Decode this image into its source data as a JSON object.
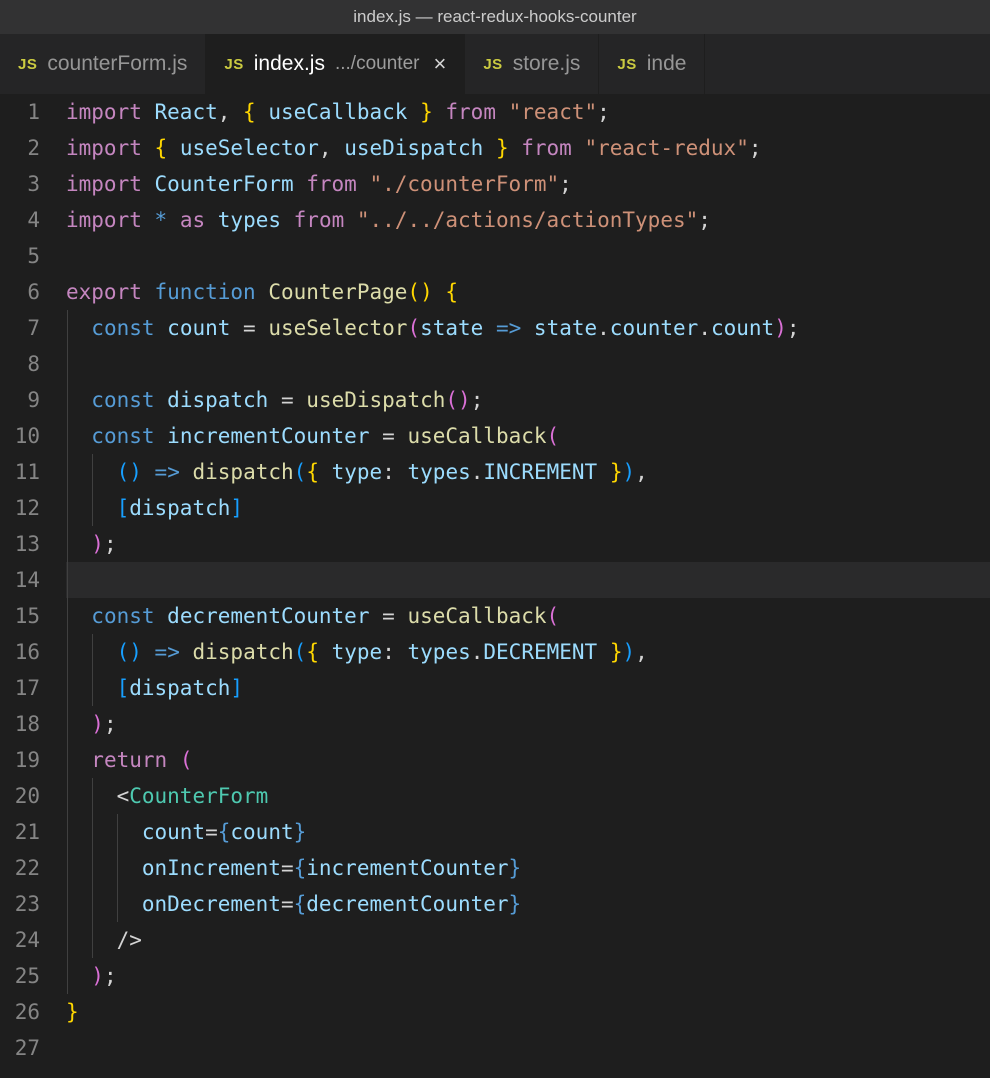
{
  "titlebar": "index.js — react-redux-hooks-counter",
  "tabs": [
    {
      "icon": "JS",
      "label": "counterForm.js",
      "path": "",
      "active": false,
      "close": false
    },
    {
      "icon": "JS",
      "label": "index.js",
      "path": ".../counter",
      "active": true,
      "close": true
    },
    {
      "icon": "JS",
      "label": "store.js",
      "path": "",
      "active": false,
      "close": false
    },
    {
      "icon": "JS",
      "label": "inde",
      "path": "",
      "active": false,
      "close": false
    }
  ],
  "lineCount": 27,
  "currentLine": 14,
  "code": {
    "l1": [
      [
        "k",
        "import"
      ],
      [
        "w",
        " "
      ],
      [
        "v",
        "React"
      ],
      [
        "p",
        ", "
      ],
      [
        "br",
        "{"
      ],
      [
        "w",
        " "
      ],
      [
        "v",
        "useCallback"
      ],
      [
        "w",
        " "
      ],
      [
        "br",
        "}"
      ],
      [
        "w",
        " "
      ],
      [
        "k",
        "from"
      ],
      [
        "w",
        " "
      ],
      [
        "s",
        "\"react\""
      ],
      [
        "p",
        ";"
      ]
    ],
    "l2": [
      [
        "k",
        "import"
      ],
      [
        "w",
        " "
      ],
      [
        "br",
        "{"
      ],
      [
        "w",
        " "
      ],
      [
        "v",
        "useSelector"
      ],
      [
        "p",
        ", "
      ],
      [
        "v",
        "useDispatch"
      ],
      [
        "w",
        " "
      ],
      [
        "br",
        "}"
      ],
      [
        "w",
        " "
      ],
      [
        "k",
        "from"
      ],
      [
        "w",
        " "
      ],
      [
        "s",
        "\"react-redux\""
      ],
      [
        "p",
        ";"
      ]
    ],
    "l3": [
      [
        "k",
        "import"
      ],
      [
        "w",
        " "
      ],
      [
        "v",
        "CounterForm"
      ],
      [
        "w",
        " "
      ],
      [
        "k",
        "from"
      ],
      [
        "w",
        " "
      ],
      [
        "s",
        "\"./counterForm\""
      ],
      [
        "p",
        ";"
      ]
    ],
    "l4": [
      [
        "k",
        "import"
      ],
      [
        "w",
        " "
      ],
      [
        "kb",
        "*"
      ],
      [
        "w",
        " "
      ],
      [
        "k",
        "as"
      ],
      [
        "w",
        " "
      ],
      [
        "v",
        "types"
      ],
      [
        "w",
        " "
      ],
      [
        "k",
        "from"
      ],
      [
        "w",
        " "
      ],
      [
        "s",
        "\"../../actions/actionTypes\""
      ],
      [
        "p",
        ";"
      ]
    ],
    "l5": [],
    "l6": [
      [
        "k",
        "export"
      ],
      [
        "w",
        " "
      ],
      [
        "kb",
        "function"
      ],
      [
        "w",
        " "
      ],
      [
        "fn",
        "CounterPage"
      ],
      [
        "br",
        "("
      ],
      [
        "br",
        ")"
      ],
      [
        "w",
        " "
      ],
      [
        "br",
        "{"
      ]
    ],
    "l7": [
      [
        "w",
        "  "
      ],
      [
        "kb",
        "const"
      ],
      [
        "w",
        " "
      ],
      [
        "v",
        "count"
      ],
      [
        "w",
        " "
      ],
      [
        "p",
        "="
      ],
      [
        "w",
        " "
      ],
      [
        "fn",
        "useSelector"
      ],
      [
        "bp",
        "("
      ],
      [
        "v",
        "state"
      ],
      [
        "w",
        " "
      ],
      [
        "kb",
        "=>"
      ],
      [
        "w",
        " "
      ],
      [
        "v",
        "state"
      ],
      [
        "p",
        "."
      ],
      [
        "v",
        "counter"
      ],
      [
        "p",
        "."
      ],
      [
        "v",
        "count"
      ],
      [
        "bp",
        ")"
      ],
      [
        "p",
        ";"
      ]
    ],
    "l8": [],
    "l9": [
      [
        "w",
        "  "
      ],
      [
        "kb",
        "const"
      ],
      [
        "w",
        " "
      ],
      [
        "v",
        "dispatch"
      ],
      [
        "w",
        " "
      ],
      [
        "p",
        "="
      ],
      [
        "w",
        " "
      ],
      [
        "fn",
        "useDispatch"
      ],
      [
        "bp",
        "("
      ],
      [
        "bp",
        ")"
      ],
      [
        "p",
        ";"
      ]
    ],
    "l10": [
      [
        "w",
        "  "
      ],
      [
        "kb",
        "const"
      ],
      [
        "w",
        " "
      ],
      [
        "v",
        "incrementCounter"
      ],
      [
        "w",
        " "
      ],
      [
        "p",
        "="
      ],
      [
        "w",
        " "
      ],
      [
        "fn",
        "useCallback"
      ],
      [
        "bp",
        "("
      ]
    ],
    "l11": [
      [
        "w",
        "    "
      ],
      [
        "bb",
        "("
      ],
      [
        "bb",
        ")"
      ],
      [
        "w",
        " "
      ],
      [
        "kb",
        "=>"
      ],
      [
        "w",
        " "
      ],
      [
        "fn",
        "dispatch"
      ],
      [
        "bb",
        "("
      ],
      [
        "br",
        "{"
      ],
      [
        "w",
        " "
      ],
      [
        "v",
        "type"
      ],
      [
        "p",
        ":"
      ],
      [
        "w",
        " "
      ],
      [
        "v",
        "types"
      ],
      [
        "p",
        "."
      ],
      [
        "v",
        "INCREMENT"
      ],
      [
        "w",
        " "
      ],
      [
        "br",
        "}"
      ],
      [
        "bb",
        ")"
      ],
      [
        "p",
        ","
      ]
    ],
    "l12": [
      [
        "w",
        "    "
      ],
      [
        "bb",
        "["
      ],
      [
        "v",
        "dispatch"
      ],
      [
        "bb",
        "]"
      ]
    ],
    "l13": [
      [
        "w",
        "  "
      ],
      [
        "bp",
        ")"
      ],
      [
        "p",
        ";"
      ]
    ],
    "l14": [],
    "l15": [
      [
        "w",
        "  "
      ],
      [
        "kb",
        "const"
      ],
      [
        "w",
        " "
      ],
      [
        "v",
        "decrementCounter"
      ],
      [
        "w",
        " "
      ],
      [
        "p",
        "="
      ],
      [
        "w",
        " "
      ],
      [
        "fn",
        "useCallback"
      ],
      [
        "bp",
        "("
      ]
    ],
    "l16": [
      [
        "w",
        "    "
      ],
      [
        "bb",
        "("
      ],
      [
        "bb",
        ")"
      ],
      [
        "w",
        " "
      ],
      [
        "kb",
        "=>"
      ],
      [
        "w",
        " "
      ],
      [
        "fn",
        "dispatch"
      ],
      [
        "bb",
        "("
      ],
      [
        "br",
        "{"
      ],
      [
        "w",
        " "
      ],
      [
        "v",
        "type"
      ],
      [
        "p",
        ":"
      ],
      [
        "w",
        " "
      ],
      [
        "v",
        "types"
      ],
      [
        "p",
        "."
      ],
      [
        "v",
        "DECREMENT"
      ],
      [
        "w",
        " "
      ],
      [
        "br",
        "}"
      ],
      [
        "bb",
        ")"
      ],
      [
        "p",
        ","
      ]
    ],
    "l17": [
      [
        "w",
        "    "
      ],
      [
        "bb",
        "["
      ],
      [
        "v",
        "dispatch"
      ],
      [
        "bb",
        "]"
      ]
    ],
    "l18": [
      [
        "w",
        "  "
      ],
      [
        "bp",
        ")"
      ],
      [
        "p",
        ";"
      ]
    ],
    "l19": [
      [
        "w",
        "  "
      ],
      [
        "k",
        "return"
      ],
      [
        "w",
        " "
      ],
      [
        "bp",
        "("
      ]
    ],
    "l20": [
      [
        "w",
        "    "
      ],
      [
        "p",
        "<"
      ],
      [
        "cl",
        "CounterForm"
      ]
    ],
    "l21": [
      [
        "w",
        "      "
      ],
      [
        "pr",
        "count"
      ],
      [
        "p",
        "="
      ],
      [
        "kb",
        "{"
      ],
      [
        "v",
        "count"
      ],
      [
        "kb",
        "}"
      ]
    ],
    "l22": [
      [
        "w",
        "      "
      ],
      [
        "pr",
        "onIncrement"
      ],
      [
        "p",
        "="
      ],
      [
        "kb",
        "{"
      ],
      [
        "v",
        "incrementCounter"
      ],
      [
        "kb",
        "}"
      ]
    ],
    "l23": [
      [
        "w",
        "      "
      ],
      [
        "pr",
        "onDecrement"
      ],
      [
        "p",
        "="
      ],
      [
        "kb",
        "{"
      ],
      [
        "v",
        "decrementCounter"
      ],
      [
        "kb",
        "}"
      ]
    ],
    "l24": [
      [
        "w",
        "    "
      ],
      [
        "p",
        "/>"
      ]
    ],
    "l25": [
      [
        "w",
        "  "
      ],
      [
        "bp",
        ")"
      ],
      [
        "p",
        ";"
      ]
    ],
    "l26": [
      [
        "br",
        "}"
      ]
    ],
    "l27": []
  },
  "indentGuides": {
    "7": [
      0
    ],
    "8": [
      0
    ],
    "9": [
      0
    ],
    "10": [
      0
    ],
    "11": [
      0,
      1
    ],
    "12": [
      0,
      1
    ],
    "13": [
      0
    ],
    "14": [
      0
    ],
    "15": [
      0
    ],
    "16": [
      0,
      1
    ],
    "17": [
      0,
      1
    ],
    "18": [
      0
    ],
    "19": [
      0
    ],
    "20": [
      0,
      1
    ],
    "21": [
      0,
      1,
      2
    ],
    "22": [
      0,
      1,
      2
    ],
    "23": [
      0,
      1,
      2
    ],
    "24": [
      0,
      1
    ],
    "25": [
      0
    ]
  }
}
